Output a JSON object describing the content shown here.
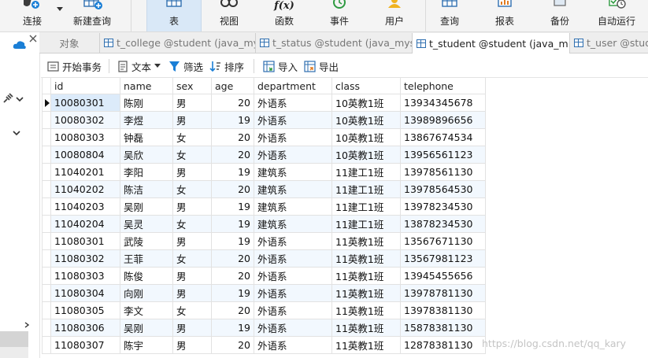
{
  "toolbar": {
    "items": [
      {
        "label": "连接",
        "icon": "connect-icon"
      },
      {
        "label": "新建查询",
        "icon": "new-query-icon"
      },
      {
        "label": "表",
        "icon": "table-icon"
      },
      {
        "label": "视图",
        "icon": "view-icon"
      },
      {
        "label": "函数",
        "icon": "function-icon"
      },
      {
        "label": "事件",
        "icon": "event-icon"
      },
      {
        "label": "用户",
        "icon": "user-icon"
      },
      {
        "label": "查询",
        "icon": "query-icon"
      },
      {
        "label": "报表",
        "icon": "report-icon"
      },
      {
        "label": "备份",
        "icon": "backup-icon"
      },
      {
        "label": "自动运行",
        "icon": "auto-run-icon"
      }
    ],
    "func_glyph": "f(x)"
  },
  "tabs": {
    "objects": "对象",
    "items": [
      {
        "label": "t_college @student (java_mys..."
      },
      {
        "label": "t_status @student (java_mys..."
      },
      {
        "label": "t_student @student (java_m..."
      },
      {
        "label": "t_user @stud"
      }
    ]
  },
  "subtoolbar": {
    "begin_transaction": "开始事务",
    "text": "文本",
    "filter": "筛选",
    "sort": "排序",
    "import": "导入",
    "export": "导出"
  },
  "grid": {
    "columns": [
      "id",
      "name",
      "sex",
      "age",
      "department",
      "class",
      "telephone"
    ],
    "rows": [
      [
        "10080301",
        "陈刚",
        "男",
        "20",
        "外语系",
        "10英教1班",
        "13934345678"
      ],
      [
        "10080302",
        "李煜",
        "男",
        "19",
        "外语系",
        "10英教1班",
        "13989896656"
      ],
      [
        "10080303",
        "钟磊",
        "女",
        "20",
        "外语系",
        "10英教1班",
        "13867674534"
      ],
      [
        "10080804",
        "吴欣",
        "女",
        "20",
        "外语系",
        "10英教1班",
        "13956561123"
      ],
      [
        "11040201",
        "李阳",
        "男",
        "19",
        "建筑系",
        "11建工1班",
        "13978561130"
      ],
      [
        "11040202",
        "陈洁",
        "女",
        "20",
        "建筑系",
        "11建工1班",
        "13978564530"
      ],
      [
        "11040203",
        "吴刚",
        "男",
        "19",
        "建筑系",
        "11建工1班",
        "13978234530"
      ],
      [
        "11040204",
        "吴灵",
        "女",
        "19",
        "建筑系",
        "11建工1班",
        "13878234530"
      ],
      [
        "11080301",
        "武陵",
        "男",
        "19",
        "外语系",
        "11英教1班",
        "13567671130"
      ],
      [
        "11080302",
        "王菲",
        "女",
        "20",
        "外语系",
        "11英教1班",
        "13567981123"
      ],
      [
        "11080303",
        "陈俊",
        "男",
        "20",
        "外语系",
        "11英教1班",
        "13945455656"
      ],
      [
        "11080304",
        "向刚",
        "男",
        "19",
        "外语系",
        "11英教1班",
        "13978781130"
      ],
      [
        "11080305",
        "李文",
        "女",
        "20",
        "外语系",
        "11英教1班",
        "13978381130"
      ],
      [
        "11080306",
        "吴刚",
        "男",
        "19",
        "外语系",
        "11英教1班",
        "15878381130"
      ],
      [
        "11080307",
        "陈宇",
        "男",
        "20",
        "外语系",
        "11英教1班",
        "12878381130"
      ]
    ]
  },
  "watermark": "https://blog.csdn.net/qq_kary"
}
